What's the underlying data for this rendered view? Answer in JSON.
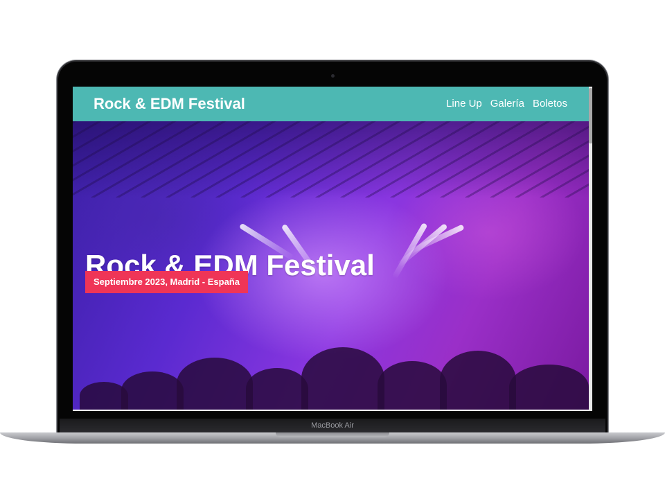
{
  "device": {
    "model_label": "MacBook Air"
  },
  "site": {
    "brand": "Rock & EDM Festival",
    "nav": [
      {
        "label": "Line Up"
      },
      {
        "label": "Galería"
      },
      {
        "label": "Boletos"
      }
    ],
    "hero": {
      "title": "Rock & EDM Festival",
      "badge": "Septiembre 2023, Madrid - España"
    }
  },
  "colors": {
    "navbar": "#4db8b3",
    "badge": "#ef3557",
    "hero_primary": "#5a2ad0",
    "hero_secondary": "#9a2fc8"
  },
  "icons": {
    "camera": "camera-dot-icon"
  }
}
